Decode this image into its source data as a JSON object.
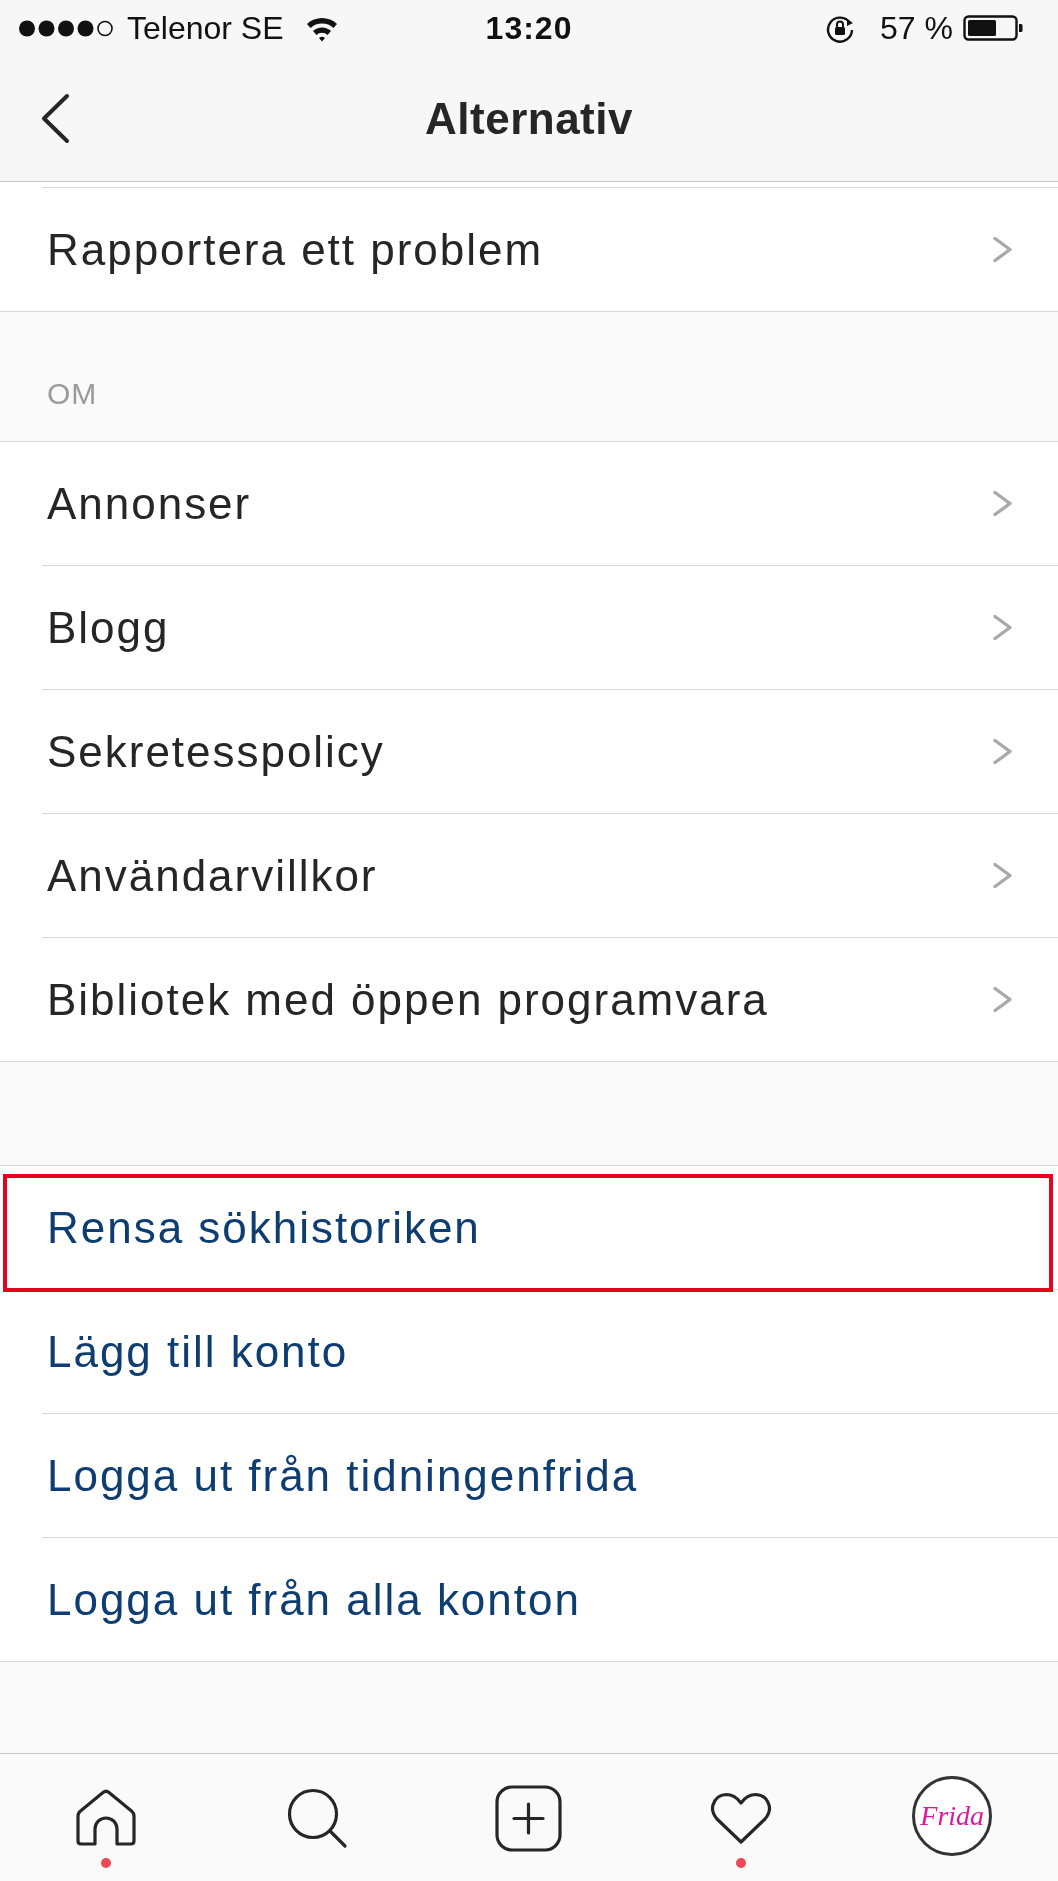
{
  "status_bar": {
    "carrier": "Telenor SE",
    "time": "13:20",
    "battery": "57 %"
  },
  "nav_bar": {
    "title": "Alternativ"
  },
  "sections": [
    {
      "items": [
        {
          "label": "Rapportera ett problem",
          "kind": "link",
          "highlighted": false
        }
      ]
    },
    {
      "header": "OM",
      "items": [
        {
          "label": "Annonser",
          "kind": "link",
          "highlighted": false
        },
        {
          "label": "Blogg",
          "kind": "link",
          "highlighted": false
        },
        {
          "label": "Sekretesspolicy",
          "kind": "link",
          "highlighted": false
        },
        {
          "label": "Användarvillkor",
          "kind": "link",
          "highlighted": false
        },
        {
          "label": "Bibliotek med öppen programvara",
          "kind": "link",
          "highlighted": false
        }
      ]
    },
    {
      "items": [
        {
          "label": "Rensa sökhistoriken",
          "kind": "action",
          "highlighted": true
        },
        {
          "label": "Lägg till konto",
          "kind": "action",
          "highlighted": false
        },
        {
          "label": "Logga ut från tidningenfrida",
          "kind": "action",
          "highlighted": false
        },
        {
          "label": "Logga ut från alla konton",
          "kind": "action",
          "highlighted": false
        }
      ]
    }
  ],
  "tab_bar": {
    "items": [
      {
        "kind": "home",
        "notification": true
      },
      {
        "kind": "search",
        "notification": false
      },
      {
        "kind": "add",
        "notification": false
      },
      {
        "kind": "activity",
        "notification": true
      },
      {
        "kind": "profile",
        "label": "Frida",
        "notification": false
      }
    ]
  }
}
